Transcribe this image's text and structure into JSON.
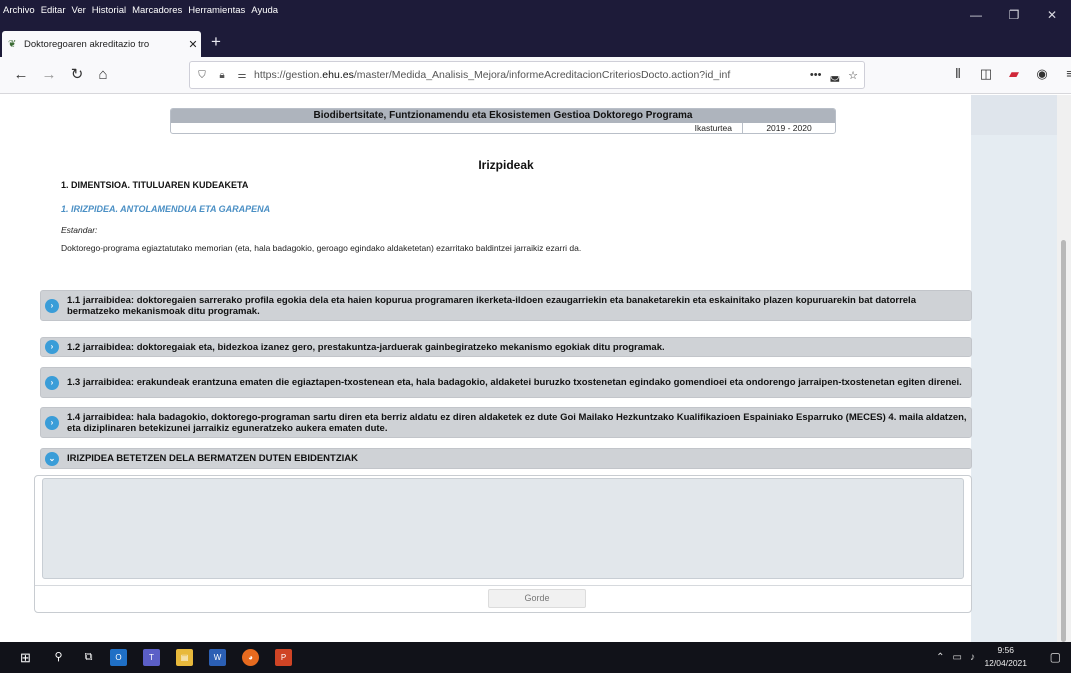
{
  "menu": [
    "Archivo",
    "Editar",
    "Ver",
    "Historial",
    "Marcadores",
    "Herramientas",
    "Ayuda"
  ],
  "window_controls": {
    "minimize": "—",
    "restore": "❐",
    "close": "✕"
  },
  "tab": {
    "title": "Doktoregoaren akreditazio tro",
    "close": "✕",
    "new_tab": "+"
  },
  "nav": {
    "back": "←",
    "forward": "→",
    "reload": "↻",
    "home": "⌂"
  },
  "url": {
    "prefix": "https://gestion.",
    "domain": "ehu.es",
    "path": "/master/Medida_Analisis_Mejora/informeAcreditacionCriteriosDocto.action?id_inf",
    "more": "•••"
  },
  "program_header": {
    "title": "Biodibertsitate, Funtzionamendu eta Ekosistemen Gestioa Doktorego Programa",
    "course_label": "Ikasturtea",
    "course_value": "2019  -  2020"
  },
  "criteria_title": "Irizpideak",
  "dimension": "1. DIMENTSIOA. TITULUAREN KUDEAKETA",
  "criterion": "1. IRIZPIDEA. ANTOLAMENDUA ETA GARAPENA",
  "standard_label": "Estandar:",
  "standard_text": "Doktorego-programa egiaztatutako memorian (eta, hala badagokio, geroago egindako aldaketetan) ezarritako baldintzei jarraikiz ezarri da.",
  "guidelines": [
    {
      "text": "1.1 jarraibidea: doktoregaien sarrerako profila egokia dela eta haien kopurua programaren ikerketa-ildoen ezaugarriekin eta banaketarekin eta eskainitako plazen kopuruarekin bat datorrela bermatzeko mekanismoak ditu programak."
    },
    {
      "text": "1.2 jarraibidea: doktoregaiak eta, bidezkoa izanez gero, prestakuntza-jarduerak gainbegiratzeko mekanismo egokiak ditu programak."
    },
    {
      "text": "1.3 jarraibidea: erakundeak erantzuna ematen die egiaztapen-txostenean eta, hala badagokio, aldaketei buruzko txostenetan egindako gomendioei eta ondorengo jarraipen-txostenetan egiten direnei."
    },
    {
      "text": "1.4 jarraibidea: hala badagokio, doktorego-programan sartu diren eta berriz aldatu ez diren aldaketek ez dute Goi Mailako Hezkuntzako Kualifikazioen Espainiako Esparruko (MECES) 4. maila aldatzen, eta diziplinaren betekizunei jarraikiz eguneratzeko aukera ematen dute."
    }
  ],
  "evidence_header": "IRIZPIDEA BETETZEN DELA BERMATZEN DUTEN EBIDENTZIAK",
  "evidence_text": "",
  "save_label": "Gorde",
  "taskbar": {
    "time": "9:56",
    "date": "12/04/2021"
  }
}
